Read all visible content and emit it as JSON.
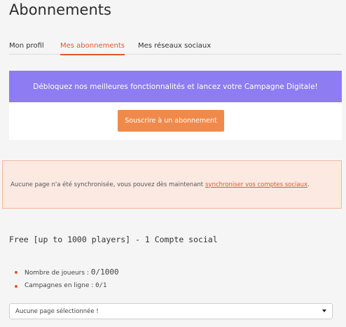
{
  "page": {
    "title": "Abonnements"
  },
  "tabs": [
    {
      "label": "Mon profil"
    },
    {
      "label": "Mes abonnements"
    },
    {
      "label": "Mes réseaux sociaux"
    }
  ],
  "promo": {
    "banner": "Débloquez nos meilleures fonctionnalités et lancez votre Campagne Digitale!",
    "button_label": "Souscrire à un abonnement"
  },
  "alert": {
    "text": "Aucune page n'a été synchronisée, vous pouvez dès maintenant",
    "link": "synchroniser vos comptes sociaux",
    "suffix": "."
  },
  "plan": {
    "title": "Free [up to 1000 players] - 1 Compte social",
    "quotas": [
      {
        "label": "Nombre de joueurs :",
        "value": "0/1000"
      },
      {
        "label": "Campagnes en ligne :",
        "value": "0/1"
      }
    ]
  },
  "page_select": {
    "selected": "Aucune page sélectionnée !"
  },
  "colors": {
    "accent": "#e0582e",
    "banner": "#8d7cf2",
    "button": "#f08a4b"
  }
}
